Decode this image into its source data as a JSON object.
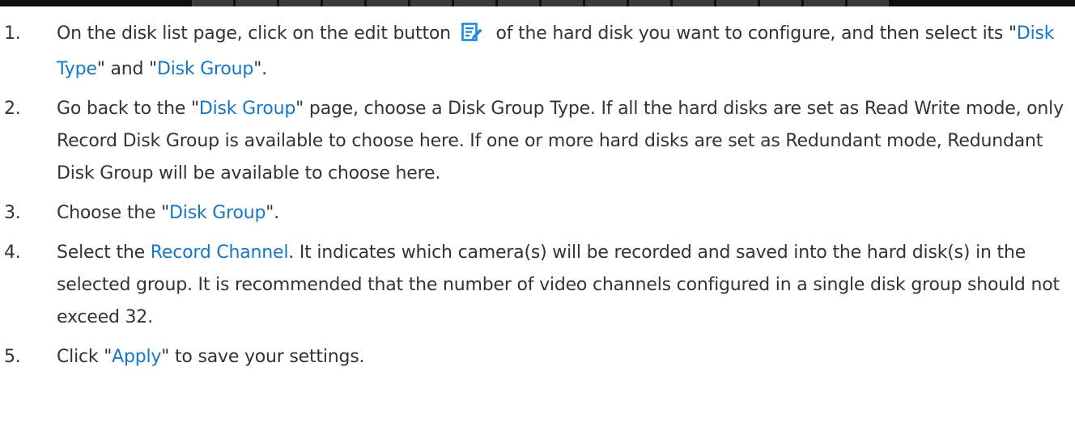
{
  "colors": {
    "text": "#333333",
    "highlight": "#1677c4",
    "icon": "#1e88e5",
    "top_strip": "#0f0f0f"
  },
  "icons": {
    "edit": "edit-icon"
  },
  "steps": [
    {
      "num": "1.",
      "before": "On the disk list page, click on the edit button",
      "after": " of the hard disk you want to configure, and then select its \"",
      "link1": "Disk Type",
      "mid": "\" and \"",
      "link2": "Disk Group",
      "end": "\"."
    },
    {
      "num": "2.",
      "before": "Go back to the \"",
      "link1": "Disk Group",
      "after": "\" page, choose a Disk Group Type. If all the hard disks are set as Read Write mode, only Record Disk Group is available to choose here. If one or more hard disks are set as Redundant mode, Redundant Disk Group will be available to choose here."
    },
    {
      "num": "3.",
      "before": "Choose the \"",
      "link1": "Disk Group",
      "after": "\"."
    },
    {
      "num": "4.",
      "before": "Select the ",
      "link1": "Record Channel",
      "after": ". It indicates which camera(s) will be recorded and saved into the hard disk(s) in the selected group. It is recommended that the number of video channels configured in a single disk group should not exceed 32."
    },
    {
      "num": "5.",
      "before": "Click \"",
      "link1": "Apply",
      "after": "\" to save your settings."
    }
  ]
}
